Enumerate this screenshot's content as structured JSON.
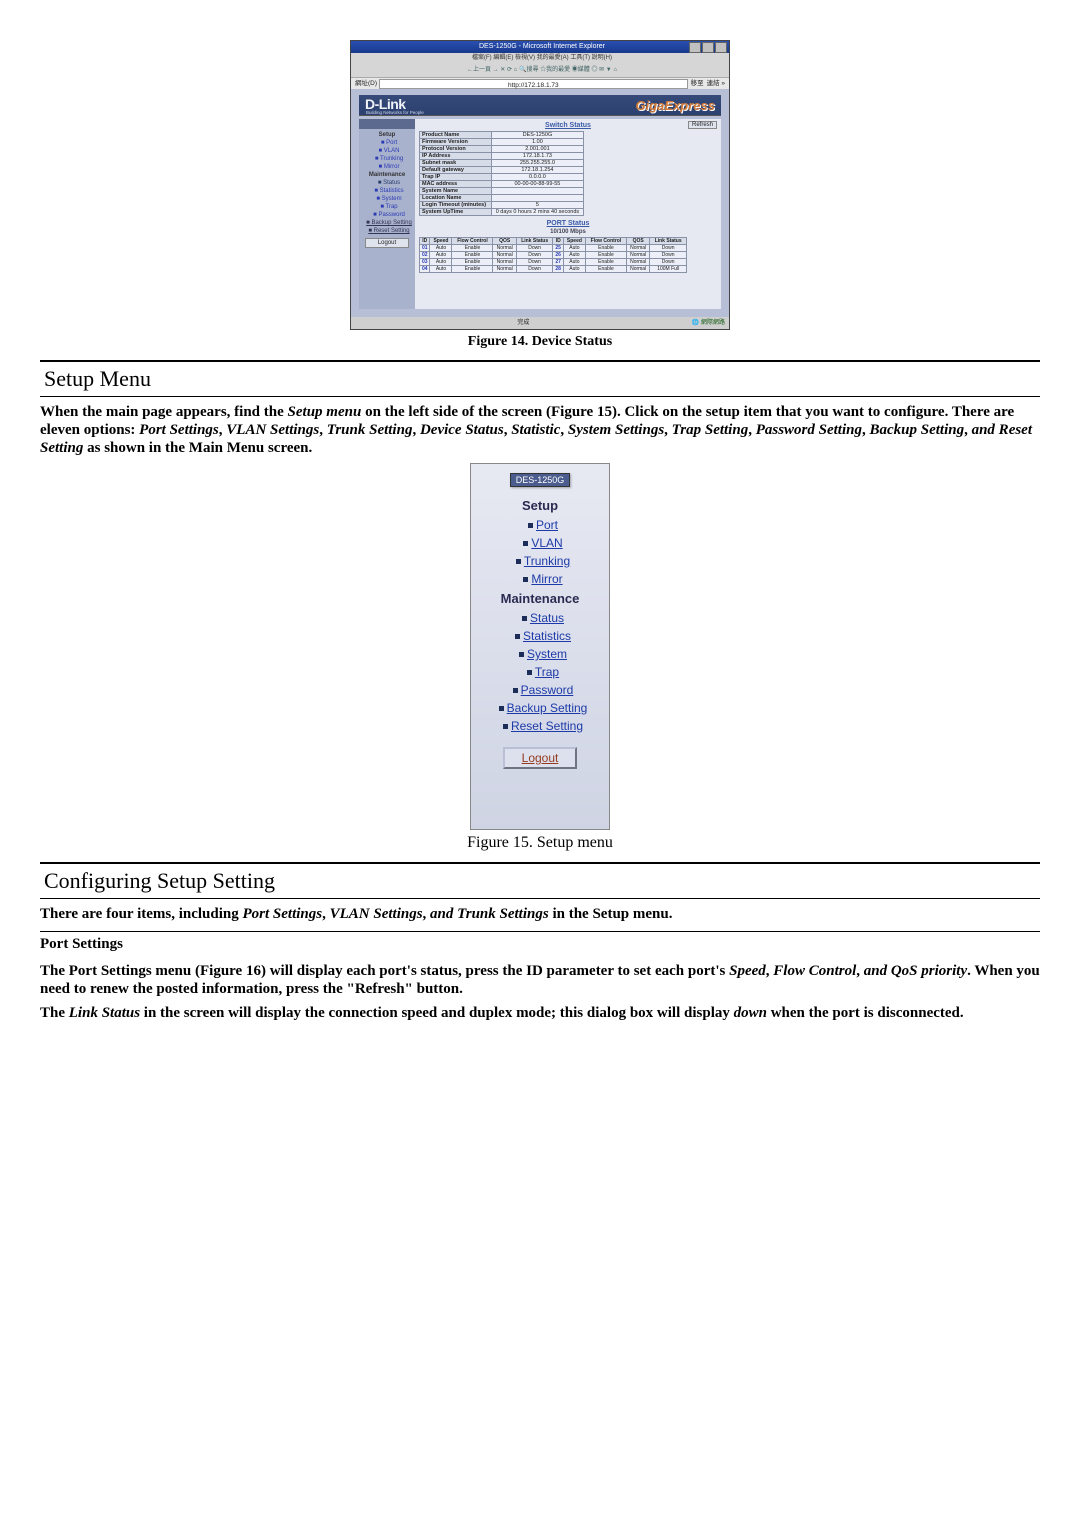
{
  "figure14": {
    "caption": "Figure 14. Device Status",
    "browser": {
      "title": "DES-1250G - Microsoft Internet Explorer",
      "menus": "檔案(F)  編輯(E)  檢視(V)  我的最愛(A)  工具(T)  說明(H)",
      "toolbar": "←上一頁  →  ✕  ⟳  ⌂  🔍搜尋  ☆我的最愛  ◉媒體  ◎  ✉  ▼  ⌂",
      "address_label": "網址(D)",
      "address": "http://172.18.1.73",
      "go": "移至",
      "links": "連結 »",
      "status_left": "完成",
      "status_right": "網際網路",
      "brand_main": "D-Link",
      "brand_sub": "Building Networks for People",
      "brand_right": "GigaExpress",
      "sidebar": {
        "setup_header": "Setup",
        "setup_items": [
          "Port",
          "VLAN",
          "Trunking",
          "Mirror"
        ],
        "maint_header": "Maintenance",
        "maint_items": [
          "Status",
          "Statistics",
          "System",
          "Trap",
          "Password",
          "Backup Setting",
          "Reset Setting"
        ],
        "logout": "Logout"
      },
      "switch_status": {
        "title": "Switch Status",
        "refresh": "Refresh",
        "rows": [
          [
            "Product Name",
            "DES-1250G"
          ],
          [
            "Firmware Version",
            "1.00"
          ],
          [
            "Protocol Version",
            "2.001.001"
          ],
          [
            "IP Address",
            "172.18.1.73"
          ],
          [
            "Subnet mask",
            "255.255.255.0"
          ],
          [
            "Default gateway",
            "172.18.1.254"
          ],
          [
            "Trap IP",
            "0.0.0.0"
          ],
          [
            "MAC address",
            "00-00-00-88-99-55"
          ],
          [
            "System Name",
            ""
          ],
          [
            "Location Name",
            ""
          ],
          [
            "Login Timeout (minutes)",
            "5"
          ],
          [
            "System UpTime",
            "0 days 0 hours 2 mins 40 seconds"
          ]
        ]
      },
      "port_status": {
        "title": "PORT Status",
        "group": "10/100 Mbps",
        "headers": [
          "ID",
          "Speed",
          "Flow Control",
          "QOS",
          "Link Status",
          "ID",
          "Speed",
          "Flow Control",
          "QOS",
          "Link Status"
        ],
        "rows": [
          [
            "01",
            "Auto",
            "Enable",
            "Normal",
            "Down",
            "25",
            "Auto",
            "Enable",
            "Normal",
            "Down"
          ],
          [
            "02",
            "Auto",
            "Enable",
            "Normal",
            "Down",
            "26",
            "Auto",
            "Enable",
            "Normal",
            "Down"
          ],
          [
            "03",
            "Auto",
            "Enable",
            "Normal",
            "Down",
            "27",
            "Auto",
            "Enable",
            "Normal",
            "Down"
          ],
          [
            "04",
            "Auto",
            "Enable",
            "Normal",
            "Down",
            "28",
            "Auto",
            "Enable",
            "Normal",
            "100M Full"
          ]
        ]
      }
    }
  },
  "setup_menu_section": {
    "heading": "Setup Menu",
    "paragraph_parts": {
      "p1a": "When the main page appears, find the ",
      "p1_em1": "Setup menu",
      "p1b": " on the left side of the screen (Figure 15). Click on the setup item that you want to configure. There are eleven options: ",
      "p1_em2": "Port Settings",
      "p1c": ", ",
      "p1_em3": "VLAN Settings",
      "p1d": ", ",
      "p1_em4": "Trunk Setting",
      "p1e": ", ",
      "p1_em5": "Device Status",
      "p1f": ", ",
      "p1_em6": "Statistic",
      "p1g": ", ",
      "p1_em7": "System Settings",
      "p1h": ", ",
      "p1_em8": "Trap Setting",
      "p1i": ", ",
      "p1_em9": "Password Setting",
      "p1j": ", ",
      "p1_em10": "Backup Setting",
      "p1k": ", ",
      "p1_em11": "and Reset Setting",
      "p1l": " as shown in the Main Menu screen."
    }
  },
  "figure15": {
    "model": "DES-1250G",
    "setup_header": "Setup",
    "setup_items": [
      "Port",
      "VLAN",
      "Trunking",
      "Mirror"
    ],
    "maint_header": "Maintenance",
    "maint_items": [
      "Status",
      "Statistics",
      "System",
      "Trap",
      "Password",
      "Backup Setting",
      "Reset Setting"
    ],
    "logout": "Logout",
    "caption": "Figure 15. Setup menu"
  },
  "config_section": {
    "heading": "Configuring Setup Setting",
    "p1a": "There are four items, including ",
    "p1_em1": "Port Settings",
    "p1b": ", ",
    "p1_em2": "VLAN Settings",
    "p1c": ", ",
    "p1_em3": "and Trunk Settings",
    "p1d": " in the Setup menu.",
    "sub_heading": "Port Settings",
    "p2a": "The Port Settings menu (Figure 16) will display each port's status, press the ID parameter to set each port's ",
    "p2_em1": "Speed",
    "p2b": ", ",
    "p2_em2": "Flow Control",
    "p2c": ", ",
    "p2_em3": "and QoS priority",
    "p2d": ". When you need to renew the posted information, press the \"Refresh\" button.",
    "p3a": "The ",
    "p3_em1": "Link Status",
    "p3b": " in the screen will display the connection speed and duplex mode; this dialog box will display ",
    "p3_em2": "down",
    "p3c": " when the port is disconnected."
  }
}
